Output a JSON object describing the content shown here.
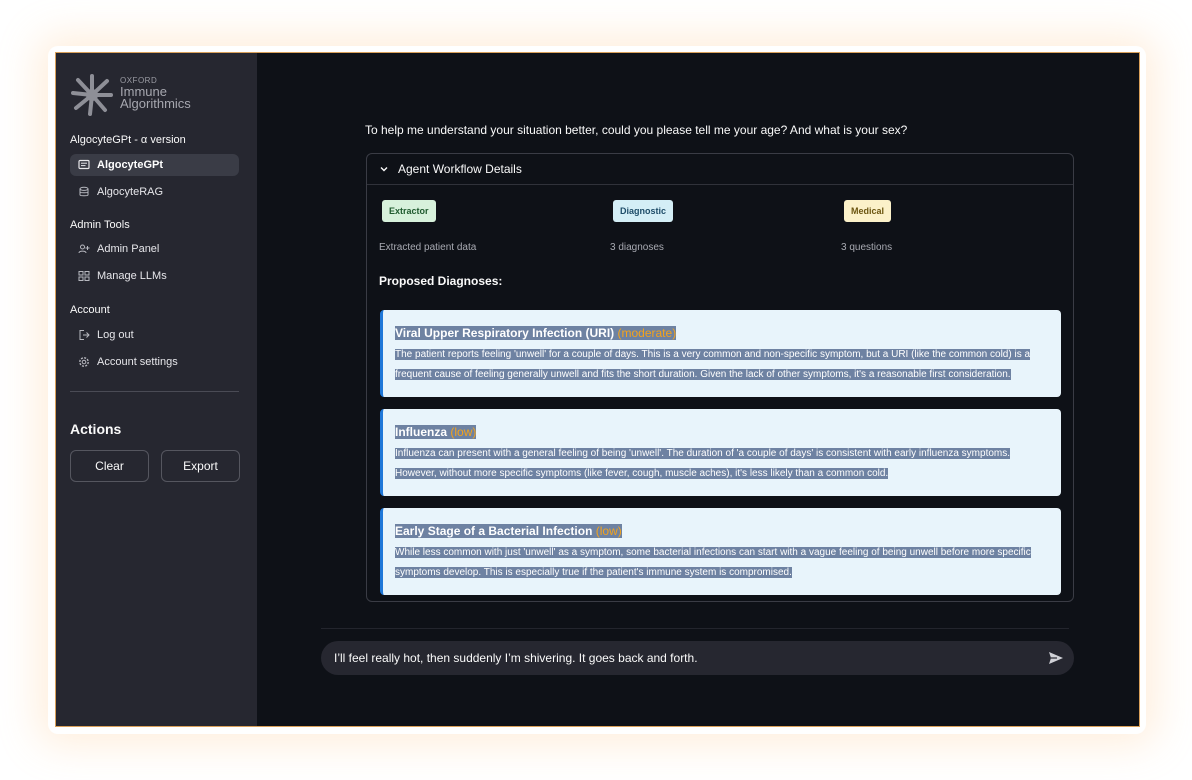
{
  "logo": {
    "oxford": "OXFORD",
    "line1": "Immune",
    "line2": "Algorithmics",
    "icon": "starburst-logo-icon"
  },
  "sidebar": {
    "app_section_label": "AlgocyteGPt - α version",
    "app_items": [
      {
        "label": "AlgocyteGPt",
        "icon": "chat-icon",
        "active": true
      },
      {
        "label": "AlgocyteRAG",
        "icon": "database-icon",
        "active": false
      }
    ],
    "admin_section_label": "Admin Tools",
    "admin_items": [
      {
        "label": "Admin Panel",
        "icon": "person-add-icon"
      },
      {
        "label": "Manage LLMs",
        "icon": "model-grid-icon"
      }
    ],
    "account_section_label": "Account",
    "account_items": [
      {
        "label": "Log out",
        "icon": "logout-icon"
      },
      {
        "label": "Account settings",
        "icon": "gear-icon"
      }
    ],
    "actions_title": "Actions",
    "clear_label": "Clear",
    "export_label": "Export"
  },
  "main": {
    "assistant_question": "To help me understand your situation better, could you please tell me your age? And what is your sex?",
    "workflow": {
      "title": "Agent Workflow Details",
      "expanded": true,
      "agents": [
        {
          "tag": "Extractor",
          "summary": "Extracted patient data",
          "color": "#d7f1db"
        },
        {
          "tag": "Diagnostic",
          "summary": "3 diagnoses",
          "color": "#d4eef6"
        },
        {
          "tag": "Medical",
          "summary": "3 questions",
          "color": "#fbf1c9"
        }
      ],
      "proposed_label": "Proposed Diagnoses:",
      "diagnoses": [
        {
          "name": "Viral Upper Respiratory Infection (URI)",
          "likelihood": "(moderate)",
          "description": "The patient reports feeling 'unwell' for a couple of days. This is a very common and non-specific symptom, but a URI (like the common cold) is a frequent cause of feeling generally unwell and fits the short duration. Given the lack of other symptoms, it's a reasonable first consideration."
        },
        {
          "name": "Influenza",
          "likelihood": "(low)",
          "description": "Influenza can present with a general feeling of being 'unwell'. The duration of 'a couple of days' is consistent with early influenza symptoms. However, without more specific symptoms (like fever, cough, muscle aches), it's less likely than a common cold."
        },
        {
          "name": "Early Stage of a Bacterial Infection",
          "likelihood": "(low)",
          "description": "While less common with just 'unwell' as a symptom, some bacterial infections can start with a vague feeling of being unwell before more specific symptoms develop. This is especially true if the patient's immune system is compromised."
        }
      ]
    },
    "chat_input_value": "I’ll feel really hot, then suddenly I’m shivering. It goes back and forth.",
    "send_icon": "send-icon"
  },
  "colors": {
    "app_bg": "#0e1117",
    "sidebar_bg": "#262730",
    "card_bg": "#e8f4fb",
    "card_accent": "#1f77d8",
    "likelihood": "#f3a31c",
    "selection": "#6e82a2"
  }
}
